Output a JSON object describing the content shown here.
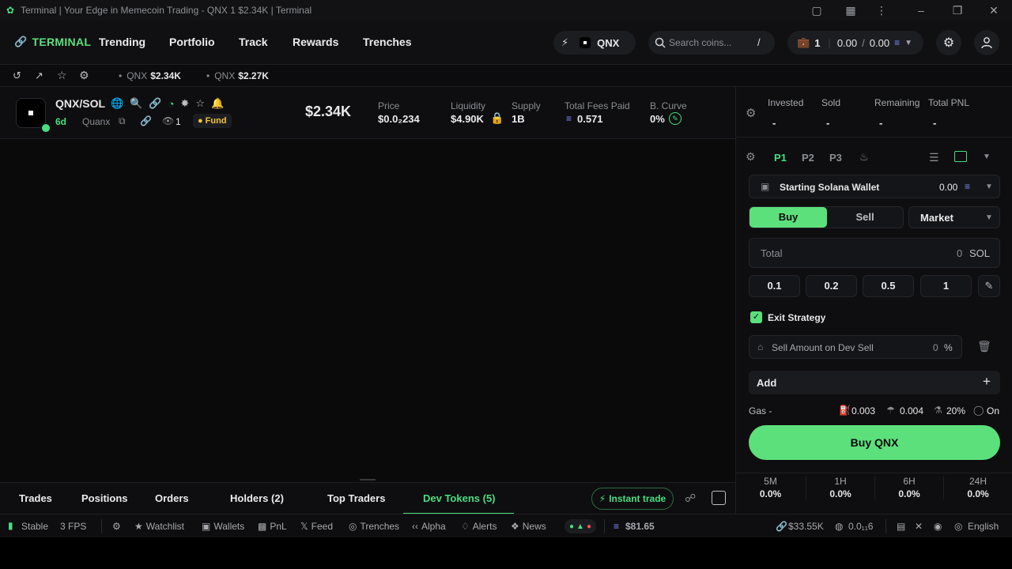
{
  "window": {
    "title": "Terminal | Your Edge in Memecoin Trading - QNX 1 $2.34K | Terminal"
  },
  "nav": {
    "brand": "TERMINAL",
    "items": [
      "Trending",
      "Portfolio",
      "Track",
      "Rewards",
      "Trenches"
    ],
    "token_chip": "QNX",
    "search_placeholder": "Search coins...",
    "search_shortcut": "/",
    "wallet_count": "1",
    "wallet_bal_1": "0.00",
    "wallet_bal_2": "0.00"
  },
  "ticker": [
    {
      "symbol": "QNX",
      "value": "$2.34K"
    },
    {
      "symbol": "QNX",
      "value": "$2.27K"
    }
  ],
  "token": {
    "pair": "QNX/SOL",
    "age": "6d",
    "creator": "Quanx",
    "watchers": "1",
    "fund_label": "Fund",
    "market_cap": "$2.34K",
    "stats": [
      {
        "label": "Price",
        "value": "$0.0₂234"
      },
      {
        "label": "Liquidity",
        "value": "$4.90K"
      },
      {
        "label": "Supply",
        "value": "1B"
      },
      {
        "label": "Total Fees Paid",
        "value": "0.571"
      },
      {
        "label": "B. Curve",
        "value": "0%"
      }
    ]
  },
  "bottom_tabs": [
    "Trades",
    "Positions",
    "Orders",
    "Holders (2)",
    "Top Traders",
    "Dev Tokens (5)"
  ],
  "active_tab": "Dev Tokens (5)",
  "instant_trade": "Instant trade",
  "footer": {
    "status": "Stable",
    "fps": "3 FPS",
    "items": [
      "Watchlist",
      "Wallets",
      "PnL",
      "Feed",
      "Trenches",
      "Alpha",
      "Alerts",
      "News"
    ],
    "sol_price": "$81.65",
    "mcap": "$33.55K",
    "gas": "0.0₁₁6",
    "language": "English"
  },
  "panel": {
    "headers": [
      {
        "label": "Invested",
        "value": "-"
      },
      {
        "label": "Sold",
        "value": "-"
      },
      {
        "label": "Remaining",
        "value": "-"
      },
      {
        "label": "Total PNL",
        "value": "-"
      }
    ],
    "presets": [
      "P1",
      "P2",
      "P3"
    ],
    "wallet_name": "Starting Solana Wallet",
    "wallet_balance": "0.00",
    "buy_label": "Buy",
    "sell_label": "Sell",
    "order_type": "Market",
    "total_label": "Total",
    "total_value": "0",
    "total_unit": "SOL",
    "quick_amounts": [
      "0.1",
      "0.2",
      "0.5",
      "1"
    ],
    "exit_strategy": "Exit Strategy",
    "sell_dev_label": "Sell Amount on Dev Sell",
    "sell_dev_value": "0",
    "sell_dev_unit": "%",
    "add_label": "Add",
    "gas_label": "Gas -",
    "fee_1": "0.003",
    "fee_2": "0.004",
    "slippage": "20%",
    "mev": "On",
    "buy_button": "Buy QNX",
    "timeframes": [
      {
        "tf": "5M",
        "pct": "0.0%"
      },
      {
        "tf": "1H",
        "pct": "0.0%"
      },
      {
        "tf": "6H",
        "pct": "0.0%"
      },
      {
        "tf": "24H",
        "pct": "0.0%"
      }
    ]
  },
  "colors": {
    "accent": "#4ade80",
    "background": "#0a0a0b",
    "danger": "#f05252"
  }
}
